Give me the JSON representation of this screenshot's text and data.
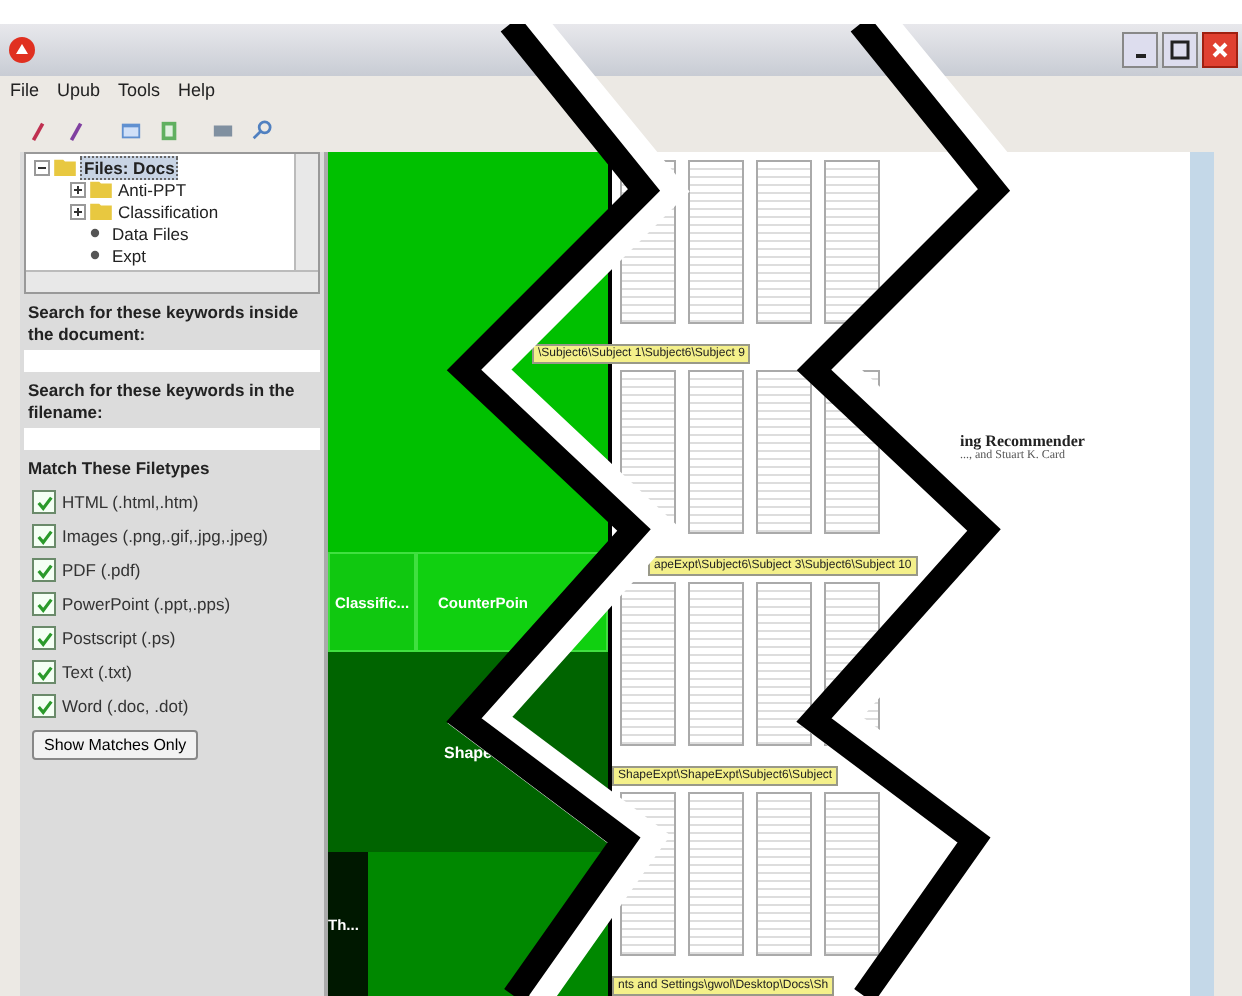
{
  "menu": [
    "File",
    "Upub",
    "Tools",
    "Help"
  ],
  "tree": {
    "label": "Files: Docs",
    "selected": true,
    "expanded": true,
    "children": [
      {
        "label": "Anti-PPT",
        "kind": "folder"
      },
      {
        "label": "Classification",
        "kind": "folder"
      },
      {
        "label": "Data Files",
        "kind": "leaf"
      },
      {
        "label": "Expt",
        "kind": "leaf"
      }
    ]
  },
  "search_document": {
    "label": "Search for these keywords inside the document:"
  },
  "search_filename": {
    "label": "Search for these keywords in the filename:"
  },
  "filetypes": {
    "title": "Match These Filetypes",
    "items": [
      {
        "label": "HTML (.html,.htm)",
        "checked": true
      },
      {
        "label": "Images (.png,.gif,.jpg,.jpeg)",
        "checked": true
      },
      {
        "label": "PDF (.pdf)",
        "checked": true
      },
      {
        "label": "PowerPoint (.ppt,.pps)",
        "checked": true
      },
      {
        "label": "Postscript (.ps)",
        "checked": true
      },
      {
        "label": "Text (.txt)",
        "checked": true
      },
      {
        "label": "Word (.doc, .dot)",
        "checked": true
      }
    ]
  },
  "show_button": "Show Matches Only",
  "treemap": {
    "cells": [
      {
        "label": "Classific...",
        "color": "#10c810"
      },
      {
        "label": "CounterPoin",
        "color": "#10d010"
      },
      {
        "label": "Shape",
        "color": "#006400"
      },
      {
        "label": "Th...",
        "color": "#001800"
      }
    ]
  },
  "thumbnail_labels": [
    "\\Subject6\\Subject 1\\Subject6\\Subject 9",
    "apeExpt\\Subject6\\Subject 3\\Subject6\\Subject 10",
    "ShapeExpt\\ShapeExpt\\Subject6\\Subject",
    "nts and Settings\\gwol\\Desktop\\Docs\\Sh"
  ],
  "document": {
    "title": "ing Recommender",
    "authors": "..., and Stuart K. Card"
  }
}
